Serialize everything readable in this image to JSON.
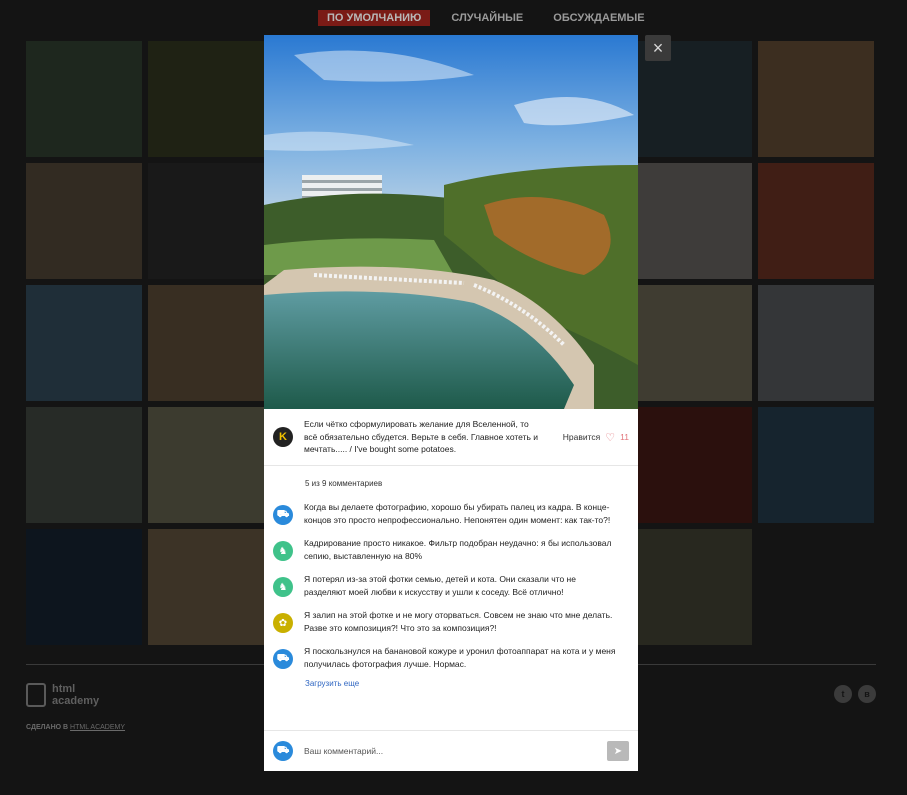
{
  "filters": [
    {
      "label": "По умолчанию",
      "active": true
    },
    {
      "label": "Случайные",
      "active": false
    },
    {
      "label": "Обсуждаемые",
      "active": false
    }
  ],
  "thumbnails": [
    {
      "color": "#6c8a6a"
    },
    {
      "color": "#6f7a48"
    },
    {
      "color": "#6a7a66"
    },
    {
      "color": "#647a7e"
    },
    {
      "color": "#5d6f78"
    },
    {
      "color": "#53707e"
    },
    {
      "color": "#d8a472"
    },
    {
      "color": "#b49a7a"
    },
    {
      "color": "#5a5a5a"
    },
    {
      "color": "#807060"
    },
    {
      "color": "#d8c4b0"
    },
    {
      "color": "#b7a290"
    },
    {
      "color": "#ded6d0"
    },
    {
      "color": "#e46a4a"
    },
    {
      "color": "#6fa3c8"
    },
    {
      "color": "#c9a47a"
    },
    {
      "color": "#c8b29a"
    },
    {
      "color": "#6e8ea8"
    },
    {
      "color": "#4a6e88"
    },
    {
      "color": "#e2d6b0"
    },
    {
      "color": "#b8c0c8"
    },
    {
      "color": "#8c9a8a"
    },
    {
      "color": "#d7d1a8"
    },
    {
      "color": "#d8c8a0"
    },
    {
      "color": "#c86450"
    },
    {
      "color": "#b84a3a"
    },
    {
      "color": "#983a2e"
    },
    {
      "color": "#4f80a4"
    },
    {
      "color": "#2e4a6a"
    },
    {
      "color": "#d6b686"
    },
    {
      "color": "#8a9660"
    },
    {
      "color": "#7a8a56"
    },
    {
      "color": "#6d7a5a"
    },
    {
      "color": "#8e9070"
    },
    {
      "color": "empty"
    }
  ],
  "footer": {
    "logo_text": "html academy",
    "made_by_prefix": "Сделано в",
    "made_by_link": "HTML Academy",
    "social": [
      "Twitter",
      "ВКонтакте"
    ],
    "social_glyphs": [
      "t",
      "в"
    ]
  },
  "modal": {
    "close_glyph": "×",
    "caption": {
      "avatar_letter": "K",
      "text": "Если чётко сформулировать желание для Вселенной, то всё обязательно сбудется. Верьте в себя. Главное хотеть и мечтать..... / I've bought some potatoes.",
      "like_label": "Нравится",
      "like_count": "11"
    },
    "comments_count": "5 из 9 комментариев",
    "comments": [
      {
        "avatar": "truck-icon",
        "color": "#2a8adb",
        "glyph": "⛟",
        "text": "Когда вы делаете фотографию, хорошо бы убирать палец из кадра. В конце-концов это просто непрофессионально. Непонятен один момент: как так-то?!"
      },
      {
        "avatar": "bell-icon",
        "color": "#3fc28a",
        "glyph": "♞",
        "text": "Кадрирование просто никакое. Фильтр подобран неудачно: я бы использовал сепию, выставленную на 80%"
      },
      {
        "avatar": "bell-icon",
        "color": "#3fc28a",
        "glyph": "♞",
        "text": "Я потерял из-за этой фотки семью, детей и кота. Они сказали что не разделяют моей любви к искусству и ушли к соседу. Всё отлично!"
      },
      {
        "avatar": "flower-icon",
        "color": "#c9b000",
        "glyph": "✿",
        "text": "Я залип на этой фотке и не могу оторваться. Совсем не знаю что мне делать. Разве это композиция?! Что это за композиция?!"
      },
      {
        "avatar": "truck-icon",
        "color": "#2a8adb",
        "glyph": "⛟",
        "text": "Я поскользнулся на банановой кожуре и уронил фотоаппарат на кота и у меня получилась фотография лучше. Нормас."
      }
    ],
    "load_more": "Загрузить еще",
    "form": {
      "avatar_color": "#2a8adb",
      "avatar_glyph": "⛟",
      "placeholder": "Ваш комментарий...",
      "send_glyph": "➤"
    }
  }
}
